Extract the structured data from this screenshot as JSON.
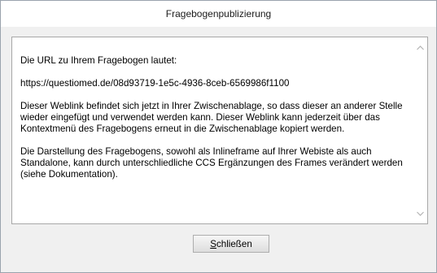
{
  "window": {
    "title": "Fragebogenpublizierung"
  },
  "message": {
    "paragraphs": [
      "Die URL zu Ihrem Fragebogen lautet:",
      "https://questiomed.de/08d93719-1e5c-4936-8ceb-6569986f1100",
      "Dieser Weblink befindet sich jetzt in Ihrer Zwischenablage, so dass dieser an anderer Stelle wieder eingefügt und verwendet werden kann. Dieser Weblink kann jederzeit über das Kontextmenü des Fragebogens erneut in die Zwischenablage kopiert werden.",
      "Die Darstellung des Fragebogens, sowohl als Inlineframe auf Ihrer Webiste als auch Standalone, kann durch unterschliedliche CCS Ergänzungen des Frames verändert werden (siehe Dokumentation)."
    ]
  },
  "scrollbar": {
    "up_icon": "chevron-up-icon",
    "down_icon": "chevron-down-icon"
  },
  "close_button": {
    "mnemonic": "S",
    "label_rest": "chließen"
  }
}
